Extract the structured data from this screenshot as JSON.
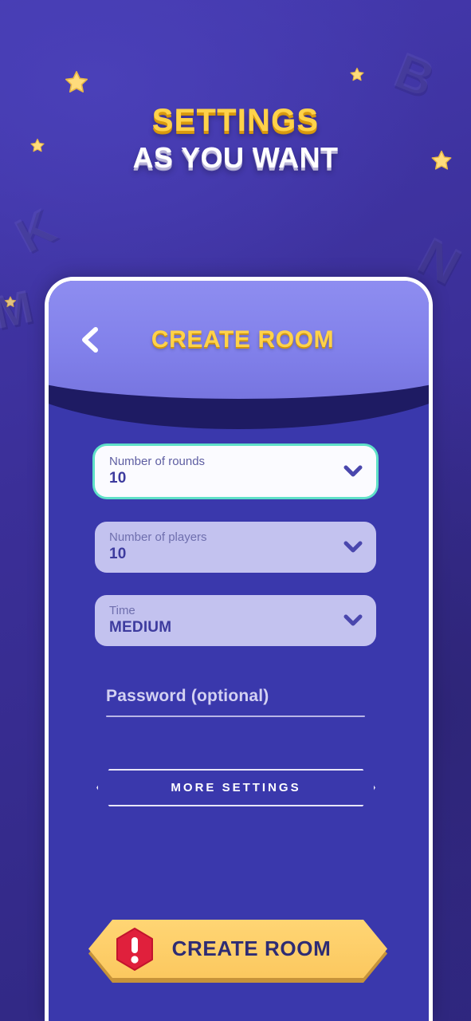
{
  "page": {
    "title_main": "SETTINGS",
    "title_sub": "AS YOU WANT",
    "background_color": "#3b2f98",
    "accent_yellow": "#ffd24a",
    "card_color": "#3a38ac",
    "header_color": "#8180ea",
    "focus_border_color": "#5fe0c8"
  },
  "decor": {
    "ghost_letters": [
      {
        "char": "K",
        "note": "left-upper faded letter"
      },
      {
        "char": "M",
        "note": "left-edge faded letter"
      },
      {
        "char": "B",
        "note": "right-upper faded letter"
      },
      {
        "char": "N",
        "note": "right-middle faded letter"
      }
    ],
    "star_count": 5
  },
  "header": {
    "back_icon": "chevron-left-icon",
    "title": "CREATE ROOM"
  },
  "form": {
    "fields": [
      {
        "label": "Number of rounds",
        "value": "10",
        "icon": "chevron-down-icon",
        "state": "focused"
      },
      {
        "label": "Number of players",
        "value": "10",
        "icon": "chevron-down-icon",
        "state": "normal"
      },
      {
        "label": "Time",
        "value": "MEDIUM",
        "icon": "chevron-down-icon",
        "state": "normal"
      }
    ],
    "password": {
      "placeholder": "Password (optional)",
      "value": ""
    }
  },
  "actions": {
    "more_settings": "MORE SETTINGS",
    "create_room": "CREATE ROOM",
    "create_room_badge_icon": "alert-exclamation-icon"
  }
}
